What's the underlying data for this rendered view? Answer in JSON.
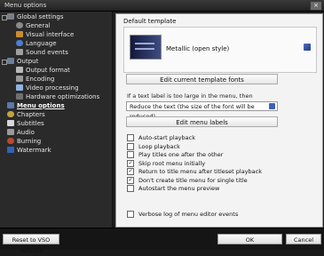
{
  "window": {
    "title": "Menu options"
  },
  "sidebar": {
    "items": [
      {
        "label": "Global settings"
      },
      {
        "label": "General"
      },
      {
        "label": "Visual interface"
      },
      {
        "label": "Language"
      },
      {
        "label": "Sound events"
      },
      {
        "label": "Output"
      },
      {
        "label": "Output format"
      },
      {
        "label": "Encoding"
      },
      {
        "label": "Video processing"
      },
      {
        "label": "Hardware optimizations"
      },
      {
        "label": "Menu options"
      },
      {
        "label": "Chapters"
      },
      {
        "label": "Subtitles"
      },
      {
        "label": "Audio"
      },
      {
        "label": "Burning"
      },
      {
        "label": "Watermark"
      }
    ]
  },
  "main": {
    "default_template_label": "Default template",
    "template_name": "Metallic (open style)",
    "edit_fonts_button": "Edit current template fonts",
    "hint_text": "If a text label is too large in the menu, then",
    "dropdown_value": "Reduce the text (the size of the font will be reduced)",
    "edit_labels_button": "Edit menu labels",
    "options": [
      {
        "label": "Auto-start playback",
        "checked": false
      },
      {
        "label": "Loop playback",
        "checked": false
      },
      {
        "label": "Play titles one after the other",
        "checked": false
      },
      {
        "label": "Skip root menu initially",
        "checked": true
      },
      {
        "label": "Return to title menu after titleset playback",
        "checked": true
      },
      {
        "label": "Don't create title menu for single title",
        "checked": true
      },
      {
        "label": "Autostart the menu preview",
        "checked": false
      }
    ],
    "verbose_option": {
      "label": "Verbose log of menu editor events",
      "checked": false
    }
  },
  "footer": {
    "reset_button": "Reset to VSO defaults",
    "ok_button": "OK",
    "cancel_button": "Cancel"
  },
  "colors": {
    "accent": "#3d61b7",
    "sidebar_bg": "#2a2a2a",
    "panel_bg": "#f3f3f3"
  }
}
